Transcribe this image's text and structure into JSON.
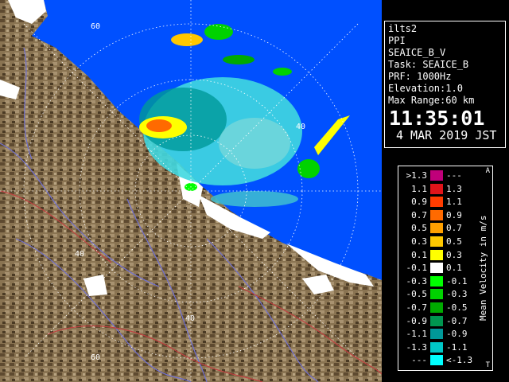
{
  "ring_labels": {
    "r60_top": "60",
    "r40_right": "40",
    "r40_left": "40",
    "r40_bottom": "40",
    "r60_bottom": "60"
  },
  "info": {
    "site": "ilts2",
    "product": "PPI",
    "scan": "SEAICE_B_V",
    "task": "Task: SEAICE_B",
    "prf": "PRF: 1000Hz",
    "elevation": "Elevation:1.0",
    "max_range": "Max Range:60 km",
    "time": "11:35:01",
    "date": "4 MAR 2019 JST"
  },
  "legend": {
    "title": "Mean Velocity in m/s",
    "corner_top": "A",
    "corner_bottom": "T",
    "rows": [
      {
        "left": ">1.3",
        "right": "---",
        "color": "#c0007a"
      },
      {
        "left": "1.1",
        "right": "1.3",
        "color": "#e0141a"
      },
      {
        "left": "0.9",
        "right": "1.1",
        "color": "#ff3c00"
      },
      {
        "left": "0.7",
        "right": "0.9",
        "color": "#ff6a00"
      },
      {
        "left": "0.5",
        "right": "0.7",
        "color": "#ffa000"
      },
      {
        "left": "0.3",
        "right": "0.5",
        "color": "#ffc800"
      },
      {
        "left": "0.1",
        "right": "0.3",
        "color": "#ffff00"
      },
      {
        "left": "-0.1",
        "right": "0.1",
        "color": "#ffffff"
      },
      {
        "left": "-0.3",
        "right": "-0.1",
        "color": "#00ff00"
      },
      {
        "left": "-0.5",
        "right": "-0.3",
        "color": "#00d200"
      },
      {
        "left": "-0.7",
        "right": "-0.5",
        "color": "#00aa00"
      },
      {
        "left": "-0.9",
        "right": "-0.7",
        "color": "#009650"
      },
      {
        "left": "-1.1",
        "right": "-0.9",
        "color": "#009898"
      },
      {
        "left": "-1.3",
        "right": "-1.1",
        "color": "#00c8c8"
      },
      {
        "left": "---",
        "right": "<-1.3",
        "color": "#00ffff"
      }
    ]
  }
}
